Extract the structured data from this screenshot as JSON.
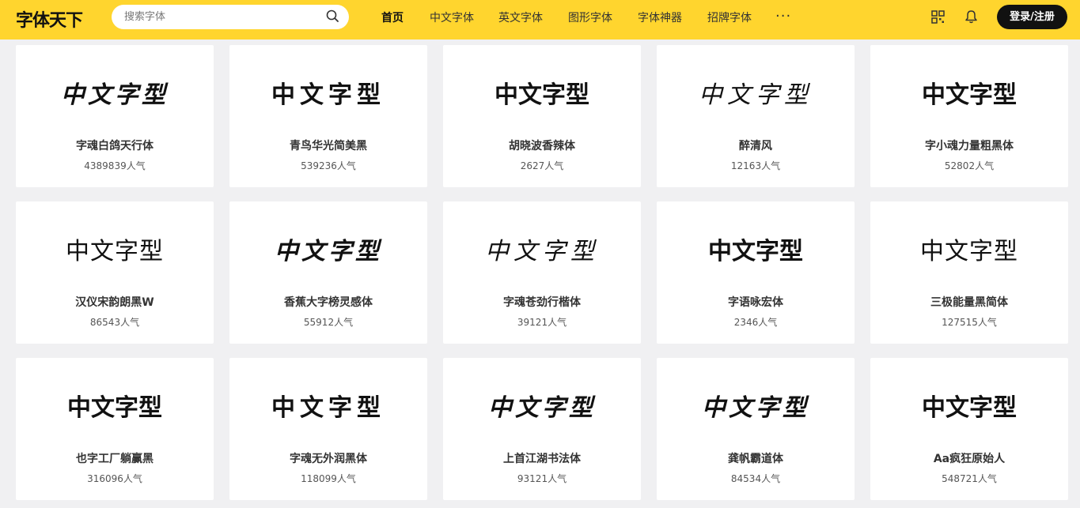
{
  "header": {
    "logo": "字体天下",
    "search_placeholder": "搜索字体",
    "nav": [
      "首页",
      "中文字体",
      "英文字体",
      "图形字体",
      "字体神器",
      "招牌字体"
    ],
    "more": "···",
    "login": "登录/注册"
  },
  "sample_text": "中文字型",
  "popularity_suffix": "人气",
  "fonts": [
    {
      "name": "字魂白鸽天行体",
      "popularity": "4389839人气",
      "style": "brush"
    },
    {
      "name": "青鸟华光简美黑",
      "popularity": "539236人气",
      "style": "round"
    },
    {
      "name": "胡晓波香辣体",
      "popularity": "2627人气",
      "style": "heavy"
    },
    {
      "name": "醉清风",
      "popularity": "12163人气",
      "style": "brush-light"
    },
    {
      "name": "字小魂力量粗黑体",
      "popularity": "52802人气",
      "style": "heavy"
    },
    {
      "name": "汉仪宋韵朗黑W",
      "popularity": "86543人气",
      "style": "light"
    },
    {
      "name": "香蕉大字榜灵感体",
      "popularity": "55912人气",
      "style": "brush"
    },
    {
      "name": "字魂苍劲行楷体",
      "popularity": "39121人气",
      "style": "brush-light"
    },
    {
      "name": "字语咏宏体",
      "popularity": "2346人气",
      "style": "heavy"
    },
    {
      "name": "三极能量黑简体",
      "popularity": "127515人气",
      "style": "light"
    },
    {
      "name": "也字工厂躺赢黑",
      "popularity": "316096人气",
      "style": "heavy"
    },
    {
      "name": "字魂无外润黑体",
      "popularity": "118099人气",
      "style": "round"
    },
    {
      "name": "上首江湖书法体",
      "popularity": "93121人气",
      "style": "brush"
    },
    {
      "name": "龚帆霸道体",
      "popularity": "84534人气",
      "style": "brush"
    },
    {
      "name": "Aa疯狂原始人",
      "popularity": "548721人气",
      "style": "heavy"
    }
  ]
}
